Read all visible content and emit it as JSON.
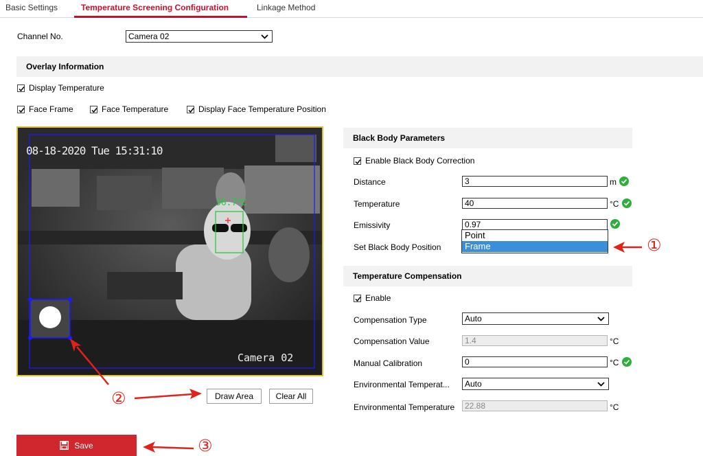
{
  "tabs": [
    {
      "label": "Basic Settings"
    },
    {
      "label": "Temperature Screening Configuration"
    },
    {
      "label": "Linkage Method"
    }
  ],
  "channel": {
    "label": "Channel No.",
    "value": "Camera 02"
  },
  "overlay": {
    "title": "Overlay Information",
    "display_temperature": "Display Temperature",
    "face_frame": "Face Frame",
    "face_temperature": "Face Temperature",
    "display_face_temp_position": "Display Face Temperature Position"
  },
  "video": {
    "timestamp": "08-18-2020 Tue 15:31:10",
    "camera_label": "Camera 02",
    "face_temp": "36.7℃"
  },
  "video_buttons": {
    "draw_area": "Draw Area",
    "clear_all": "Clear All"
  },
  "black_body": {
    "title": "Black Body Parameters",
    "enable_correction": "Enable Black Body Correction",
    "distance_label": "Distance",
    "distance_value": "3",
    "distance_unit": "m",
    "temperature_label": "Temperature",
    "temperature_value": "40",
    "temperature_unit": "°C",
    "emissivity_label": "Emissivity",
    "emissivity_value": "0.97",
    "position_label": "Set Black Body Position",
    "position_options": [
      "Point",
      "Frame"
    ],
    "position_selected": "Frame"
  },
  "compensation": {
    "title": "Temperature Compensation",
    "enable": "Enable",
    "type_label": "Compensation Type",
    "type_value": "Auto",
    "value_label": "Compensation Value",
    "value_value": "1.4",
    "value_unit": "°C",
    "manual_label": "Manual Calibration",
    "manual_value": "0",
    "manual_unit": "°C",
    "env_mode_label": "Environmental Temperat...",
    "env_mode_value": "Auto",
    "env_temp_label": "Environmental Temperature",
    "env_temp_value": "22.88",
    "env_temp_unit": "°C"
  },
  "save_label": "Save",
  "annotations": {
    "one": "①",
    "two": "②",
    "three": "③"
  },
  "colors": {
    "accent": "#c8102e",
    "ok": "#2eae3a",
    "annotation": "#e0231a",
    "selection": "#3b8fd9"
  }
}
